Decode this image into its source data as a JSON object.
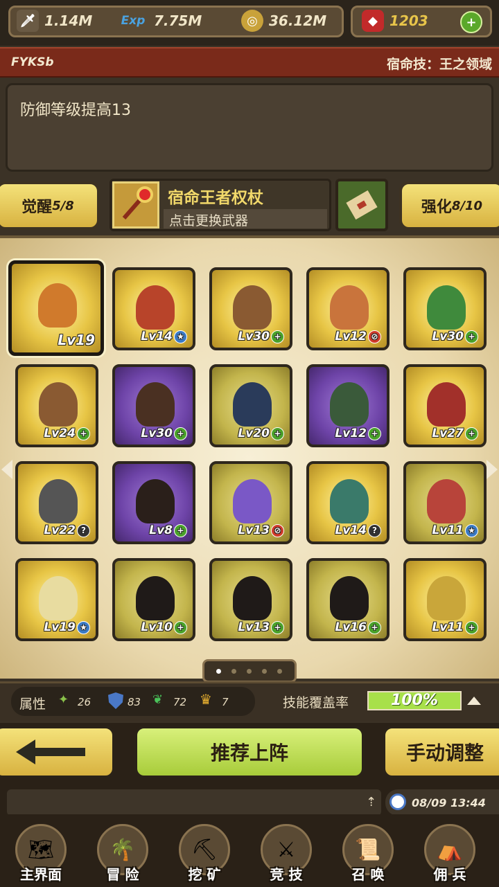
{
  "resources": {
    "attack": "1.14M",
    "exp_icon": "Exp",
    "exp": "7.75M",
    "gold": "36.12M",
    "gems": "1203"
  },
  "hero": {
    "name": "FYKSb",
    "fate_skill": "宿命技：王之领域",
    "description": "防御等级提高13"
  },
  "awaken": {
    "label": "觉醒",
    "value": "5/8"
  },
  "weapon": {
    "name": "宿命王者权杖",
    "hint": "点击更换武器"
  },
  "enhance": {
    "label": "强化",
    "value": "8/10"
  },
  "grid": [
    {
      "tile": "gold",
      "lv": "Lv19",
      "badge": "",
      "char_color": "#d07a2c"
    },
    {
      "tile": "gold",
      "lv": "Lv14",
      "badge": "star",
      "char_color": "#b8442a"
    },
    {
      "tile": "gold",
      "lv": "Lv30",
      "badge": "plus",
      "char_color": "#8a5a32"
    },
    {
      "tile": "gold",
      "lv": "Lv12",
      "badge": "no",
      "char_color": "#c9743c"
    },
    {
      "tile": "gold",
      "lv": "Lv30",
      "badge": "plus",
      "char_color": "#3f8a3c"
    },
    {
      "tile": "gold",
      "lv": "Lv24",
      "badge": "plus",
      "char_color": "#8a5a32"
    },
    {
      "tile": "purple",
      "lv": "Lv30",
      "badge": "plus",
      "char_color": "#4a3022"
    },
    {
      "tile": "olive",
      "lv": "Lv20",
      "badge": "plus",
      "char_color": "#2a3b5a"
    },
    {
      "tile": "purple",
      "lv": "Lv12",
      "badge": "plus",
      "char_color": "#3a5a3a"
    },
    {
      "tile": "gold",
      "lv": "Lv27",
      "badge": "plus",
      "char_color": "#a2302a"
    },
    {
      "tile": "gold",
      "lv": "Lv22",
      "badge": "question",
      "char_color": "#555555"
    },
    {
      "tile": "purple",
      "lv": "Lv8",
      "badge": "plus",
      "char_color": "#2a1f1a"
    },
    {
      "tile": "olive",
      "lv": "Lv13",
      "badge": "no",
      "char_color": "#7a58c6"
    },
    {
      "tile": "gold",
      "lv": "Lv14",
      "badge": "question",
      "char_color": "#3a7a6a"
    },
    {
      "tile": "olive",
      "lv": "Lv11",
      "badge": "star",
      "char_color": "#b8443a"
    },
    {
      "tile": "gold",
      "lv": "Lv19",
      "badge": "star",
      "char_color": "#e8dca0"
    },
    {
      "tile": "olive",
      "lv": "Lv10",
      "badge": "plus",
      "char_color": "#1f1a18"
    },
    {
      "tile": "olive",
      "lv": "Lv13",
      "badge": "plus",
      "char_color": "#1f1a18"
    },
    {
      "tile": "olive",
      "lv": "Lv16",
      "badge": "plus",
      "char_color": "#1f1a18"
    },
    {
      "tile": "gold",
      "lv": "Lv11",
      "badge": "plus",
      "char_color": "#c9a63a"
    }
  ],
  "pagination": {
    "total": 5,
    "current": 1
  },
  "stats": {
    "label": "属性",
    "nature": "26",
    "defense": "83",
    "speed": "72",
    "crown": "7",
    "coverage_label": "技能覆盖率",
    "coverage_value": "100%",
    "coverage_fraction": 1.0
  },
  "actions": {
    "recommend": "推荐上阵",
    "manual": "手动调整"
  },
  "chat": {
    "datetime": "08/09 13:44"
  },
  "nav": [
    {
      "label": "主界面",
      "icon": "map-icon"
    },
    {
      "label": "冒 险",
      "icon": "island-icon"
    },
    {
      "label": "挖 矿",
      "icon": "pickaxe-icon"
    },
    {
      "label": "竞 技",
      "icon": "swords-icon"
    },
    {
      "label": "召 唤",
      "icon": "scroll-icon"
    },
    {
      "label": "佣 兵",
      "icon": "tent-icon"
    }
  ],
  "colors": {
    "accent_gold": "#e7c545",
    "coverage_green": "#a8e04a",
    "header_red": "#7a2a1a"
  }
}
